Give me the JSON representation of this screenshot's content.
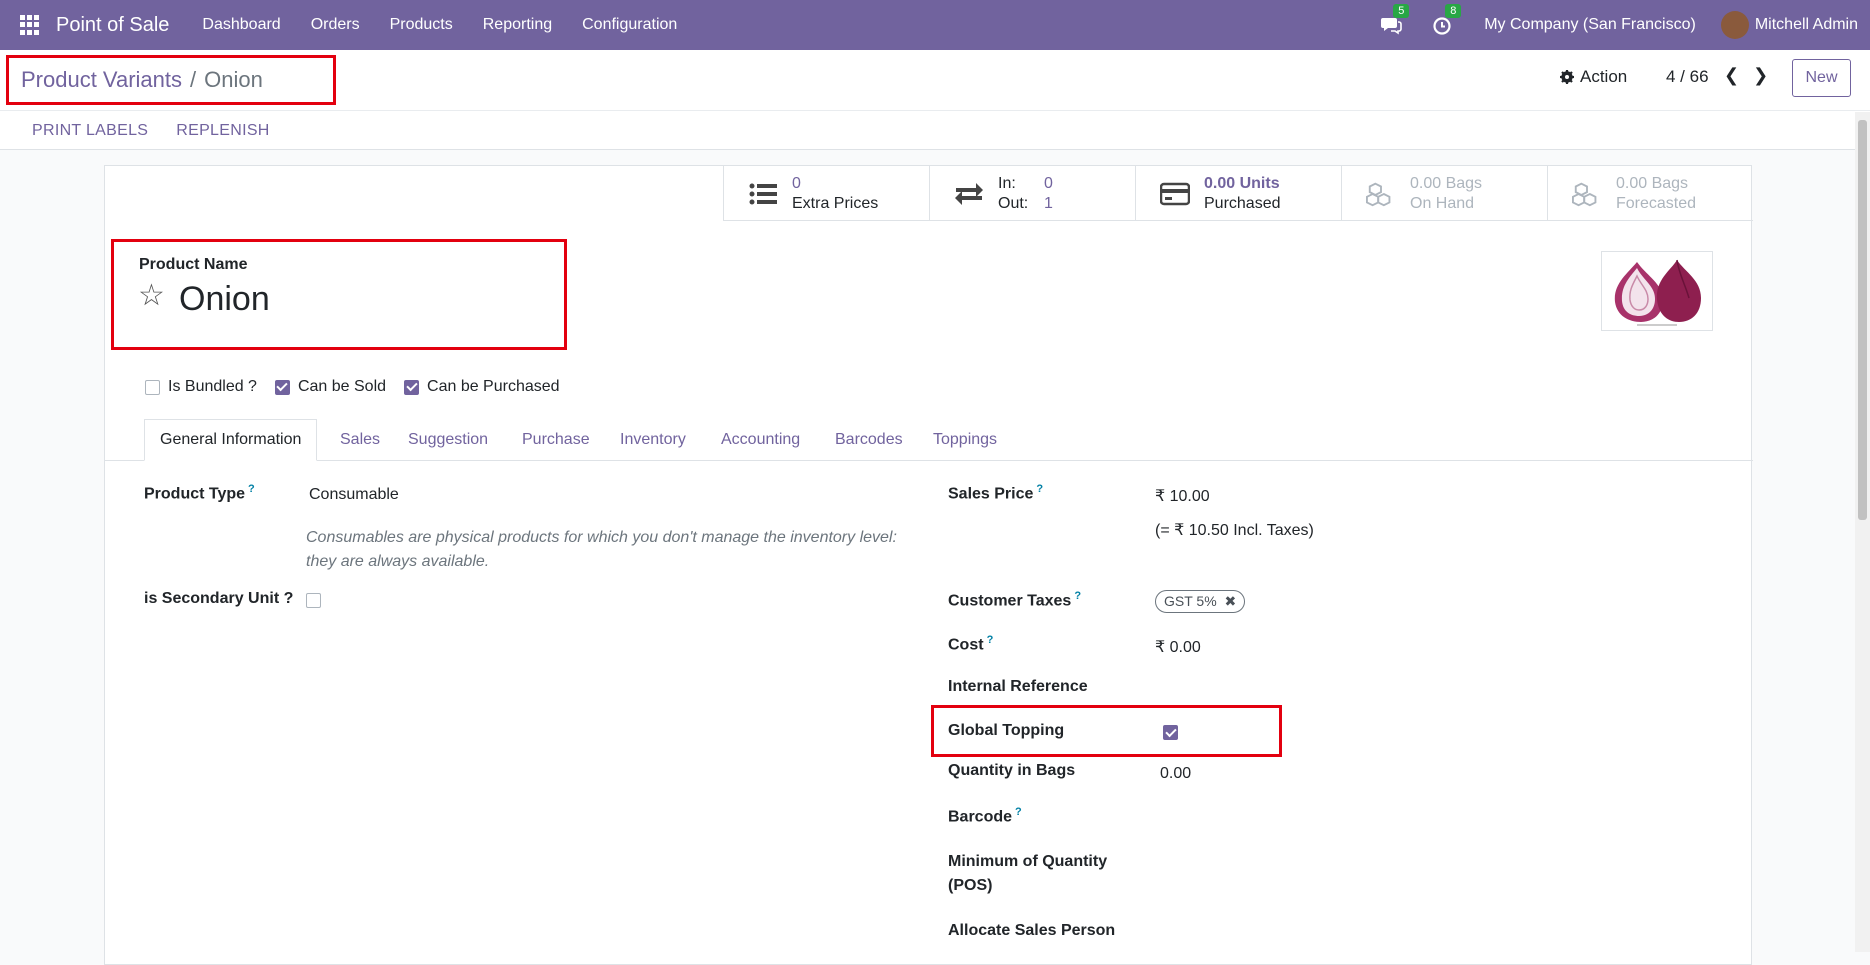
{
  "navbar": {
    "app_name": "Point of Sale",
    "menu": [
      "Dashboard",
      "Orders",
      "Products",
      "Reporting",
      "Configuration"
    ],
    "messages_count": "5",
    "activities_count": "8",
    "company": "My Company (San Francisco)",
    "user": "Mitchell Admin"
  },
  "breadcrumb": {
    "parent": "Product Variants",
    "separator": "/",
    "current": "Onion"
  },
  "control": {
    "action_label": "Action",
    "pager": "4 / 66",
    "new_label": "New"
  },
  "statusbar": {
    "print_labels": "PRINT LABELS",
    "replenish": "REPLENISH"
  },
  "smart_buttons": {
    "extra_prices": {
      "value": "0",
      "label": "Extra Prices"
    },
    "in_out": {
      "in_label": "In:",
      "in_value": "0",
      "out_label": "Out:",
      "out_value": "1"
    },
    "purchased": {
      "value": "0.00 Units",
      "label": "Purchased"
    },
    "on_hand": {
      "value": "0.00 Bags",
      "label": "On Hand"
    },
    "forecasted": {
      "value": "0.00 Bags",
      "label": "Forecasted"
    }
  },
  "product": {
    "name_label": "Product Name",
    "name": "Onion"
  },
  "checkboxes": [
    {
      "label": "Is Bundled ?",
      "checked": false
    },
    {
      "label": "Can be Sold",
      "checked": true
    },
    {
      "label": "Can be Purchased",
      "checked": true
    }
  ],
  "tabs": [
    "General Information",
    "Sales",
    "Suggestion",
    "Purchase",
    "Inventory",
    "Accounting",
    "Barcodes",
    "Toppings"
  ],
  "left_fields": {
    "product_type_label": "Product Type",
    "product_type_value": "Consumable",
    "product_type_help": "Consumables are physical products for which you don't manage the inventory level: they are always available.",
    "secondary_unit_label": "is Secondary Unit ?"
  },
  "right_fields": {
    "sales_price_label": "Sales Price",
    "sales_price_value": "₹ 10.00",
    "sales_price_incl": "(= ₹ 10.50 Incl. Taxes)",
    "customer_taxes_label": "Customer Taxes",
    "customer_taxes_tag": "GST 5%",
    "cost_label": "Cost",
    "cost_value": "₹ 0.00",
    "internal_ref_label": "Internal Reference",
    "global_topping_label": "Global Topping",
    "quantity_bags_label": "Quantity in Bags",
    "quantity_bags_value": "0.00",
    "barcode_label": "Barcode",
    "min_qty_label_1": "Minimum of Quantity",
    "min_qty_label_2": "(POS)",
    "allocate_label": "Allocate Sales Person"
  },
  "help_mark": "?",
  "colors": {
    "primary": "#71639e",
    "highlight": "#e3000f",
    "help": "#0180a5"
  }
}
